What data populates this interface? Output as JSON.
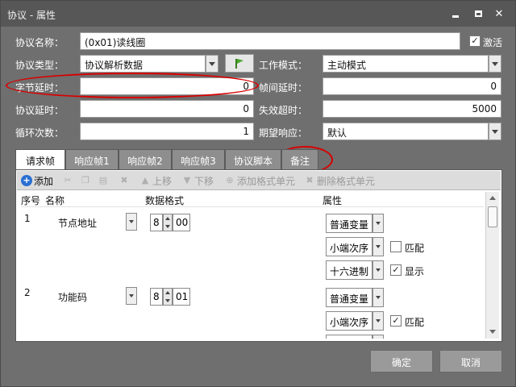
{
  "window": {
    "title": "协议 - 属性"
  },
  "form": {
    "protocol_name_label": "协议名称：",
    "protocol_name_value": "(0x01)读线圈",
    "activate_label": "激活",
    "activate_checked": "✓",
    "protocol_type_label": "协议类型：",
    "protocol_type_value": "协议解析数据",
    "work_mode_label": "工作模式：",
    "work_mode_value": "主动模式",
    "byte_delay_label": "字节延时：",
    "byte_delay_value": "0",
    "frame_delay_label": "帧间延时：",
    "frame_delay_value": "0",
    "protocol_delay_label": "协议延时：",
    "protocol_delay_value": "0",
    "timeout_label": "失效超时：",
    "timeout_value": "5000",
    "loop_count_label": "循环次数：",
    "loop_count_value": "1",
    "expect_response_label": "期望响应：",
    "expect_response_value": "默认"
  },
  "tabs": [
    "请求帧",
    "响应帧1",
    "响应帧2",
    "响应帧3",
    "协议脚本",
    "备注"
  ],
  "toolbar": {
    "add": "添加",
    "move_up": "上移",
    "move_down": "下移",
    "add_format_unit": "添加格式单元",
    "delete_format_unit": "删除格式单元"
  },
  "grid": {
    "columns": [
      "序号",
      "名称",
      "数据格式",
      "属性"
    ],
    "rows": [
      {
        "index": "1",
        "name": "节点地址",
        "format_len": "8",
        "format_val": "00",
        "var_type": "普通变量",
        "endian": "小端次序",
        "match_label": "匹配",
        "match_checked": "",
        "radix": "十六进制",
        "display_label": "显示",
        "display_checked": "✓"
      },
      {
        "index": "2",
        "name": "功能码",
        "format_len": "8",
        "format_val": "01",
        "var_type": "普通变量",
        "endian": "小端次序",
        "match_label": "匹配",
        "match_checked": "✓"
      }
    ]
  },
  "buttons": {
    "ok": "确定",
    "cancel": "取消"
  },
  "colors": {
    "annotation": "#d80000",
    "window_bg": "#6f6f6f",
    "title_bg": "#575757"
  }
}
